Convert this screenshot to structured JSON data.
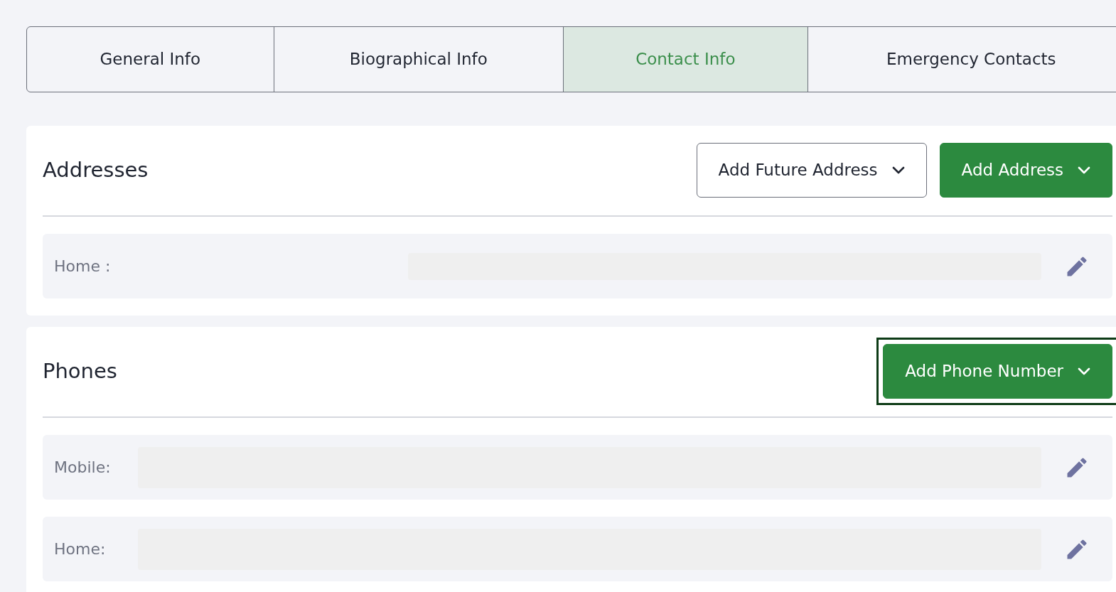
{
  "tabs": [
    {
      "label": "General Info",
      "selected": false
    },
    {
      "label": "Biographical Info",
      "selected": false
    },
    {
      "label": "Contact Info",
      "selected": true
    },
    {
      "label": "Emergency Contacts",
      "selected": false
    }
  ],
  "sections": [
    {
      "title": "Addresses",
      "buttons": [
        {
          "label": "Add Future Address",
          "kind": "outline",
          "focused": false
        },
        {
          "label": "Add Address",
          "kind": "primary",
          "focused": false
        }
      ],
      "rows": [
        {
          "label": "Home :",
          "kind": "wide"
        }
      ]
    },
    {
      "title": "Phones",
      "buttons": [
        {
          "label": "Add Phone Number",
          "kind": "primary",
          "focused": true
        }
      ],
      "rows": [
        {
          "label": "Mobile:",
          "kind": "narrow"
        },
        {
          "label": "Home:",
          "kind": "narrow"
        }
      ]
    }
  ]
}
